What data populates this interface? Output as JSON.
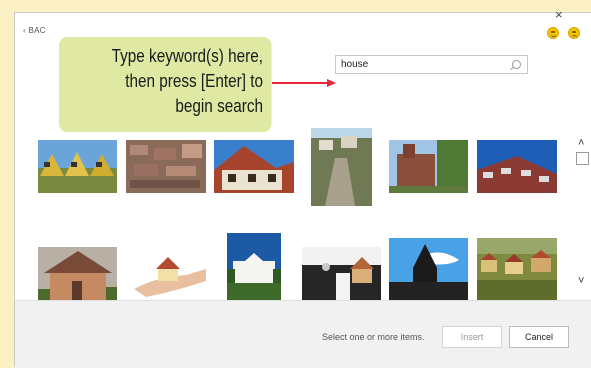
{
  "dialog": {
    "back_label": "‹ BAC",
    "close_glyph": "×",
    "status_icons": [
      "smile-icon",
      "frown-icon"
    ]
  },
  "search": {
    "value": "house",
    "icon": "search-icon"
  },
  "callout": {
    "lines": [
      "Type keyword(s) here,",
      "then press [Enter] to",
      "begin search"
    ],
    "accent_color": "#e8283a"
  },
  "results": {
    "row1": [
      "row-houses-image",
      "aerial-town-image",
      "tudor-house-image",
      "cliff-town-image",
      "castle-ruin-image",
      "city-rooftops-image"
    ],
    "row2": [
      "stone-house-image",
      "hand-holding-house-image",
      "white-house-image",
      "keys-house-image",
      "church-image",
      "village-image"
    ]
  },
  "scroll": {
    "up_glyph": "˄",
    "down_glyph": "˅"
  },
  "footer": {
    "status": "Select one or more items.",
    "insert_label": "Insert",
    "cancel_label": "Cancel"
  }
}
